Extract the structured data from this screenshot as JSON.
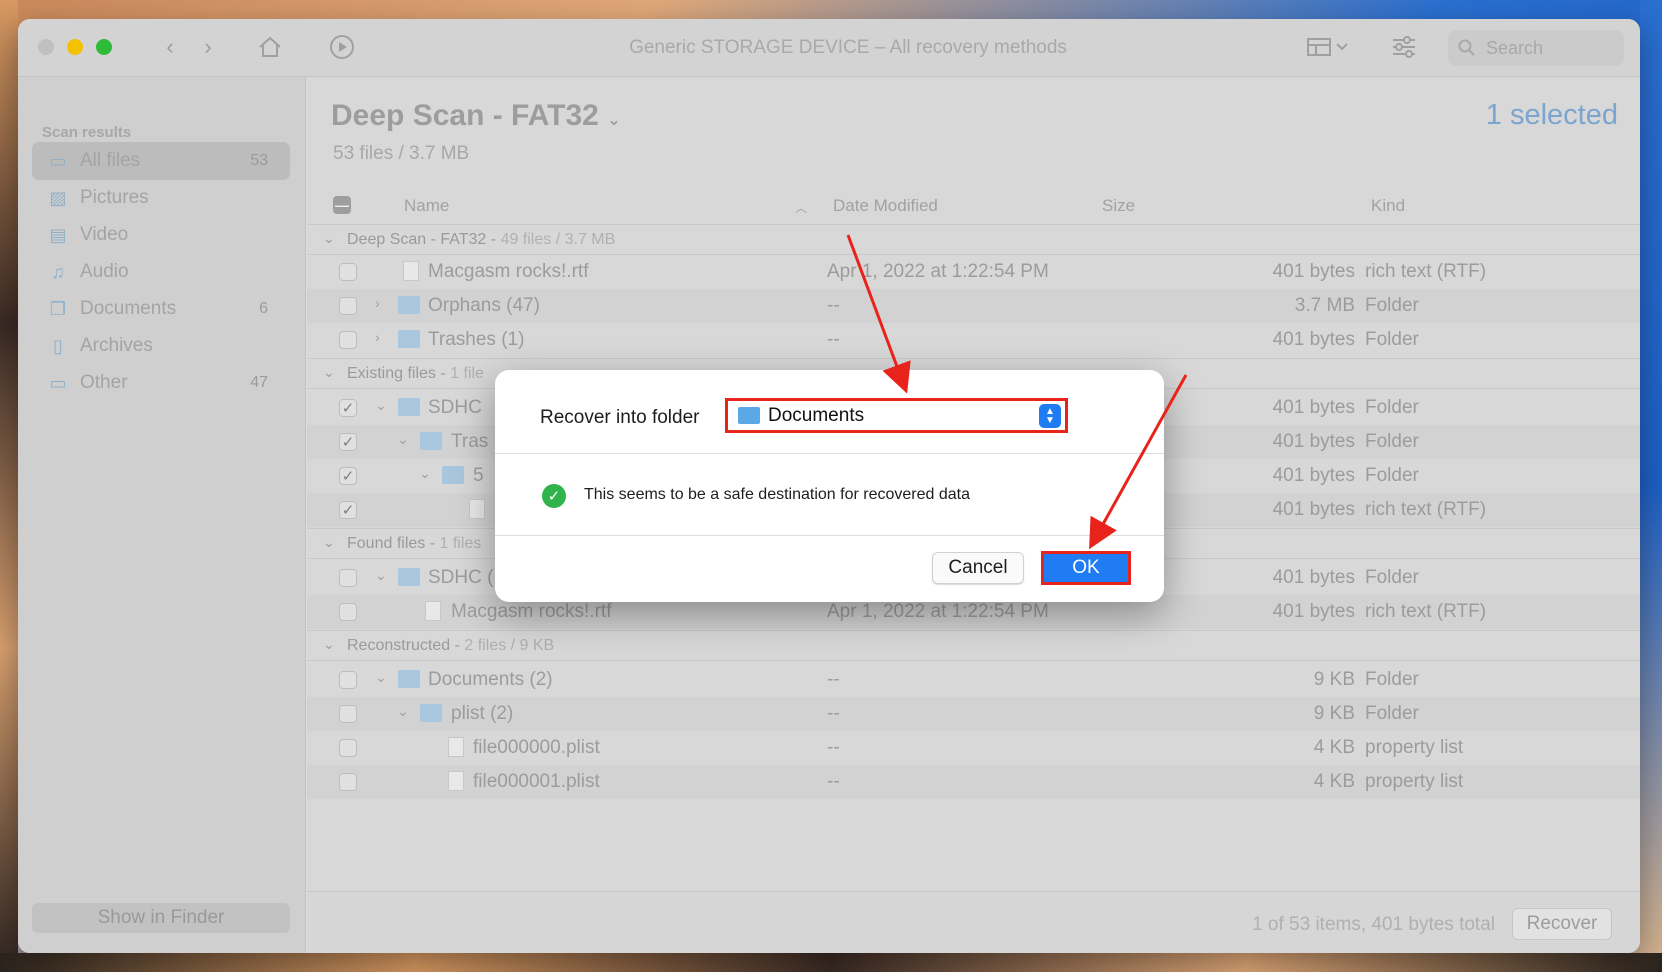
{
  "window": {
    "title": "Generic STORAGE DEVICE – All recovery methods",
    "search_placeholder": "Search"
  },
  "sidebar": {
    "header": "Scan results",
    "items": [
      {
        "label": "All files",
        "count": "53",
        "icon": "all-files-icon"
      },
      {
        "label": "Pictures",
        "count": "",
        "icon": "pictures-icon"
      },
      {
        "label": "Video",
        "count": "",
        "icon": "video-icon"
      },
      {
        "label": "Audio",
        "count": "",
        "icon": "audio-icon"
      },
      {
        "label": "Documents",
        "count": "6",
        "icon": "documents-icon"
      },
      {
        "label": "Archives",
        "count": "",
        "icon": "archives-icon"
      },
      {
        "label": "Other",
        "count": "47",
        "icon": "other-icon"
      }
    ],
    "show_in_finder": "Show in Finder"
  },
  "main": {
    "scan_title": "Deep Scan - FAT32",
    "scan_subtitle": "53 files / 3.7 MB",
    "selected": "1 selected",
    "columns": {
      "name": "Name",
      "date": "Date Modified",
      "size": "Size",
      "kind": "Kind"
    },
    "groups": {
      "deep": {
        "name": "Deep Scan - FAT32 -",
        "info": "49 files / 3.7 MB"
      },
      "existing": {
        "name": "Existing files -",
        "info": "1 file"
      },
      "found": {
        "name": "Found files -",
        "info": "1 files"
      },
      "reconstructed": {
        "name": "Reconstructed -",
        "info": "2 files / 9 KB"
      }
    },
    "rows": {
      "r1": {
        "name": "Macgasm rocks!.rtf",
        "date": "Apr 1, 2022 at 1:22:54 PM",
        "size": "401 bytes",
        "kind": "rich text (RTF)"
      },
      "r2": {
        "name": "Orphans (47)",
        "date": "--",
        "size": "3.7 MB",
        "kind": "Folder"
      },
      "r3": {
        "name": "Trashes (1)",
        "date": "--",
        "size": "401 bytes",
        "kind": "Folder"
      },
      "r4": {
        "name": "SDHC",
        "size": "401 bytes",
        "kind": "Folder"
      },
      "r5": {
        "name": "Tras",
        "size": "401 bytes",
        "kind": "Folder"
      },
      "r6": {
        "name": "5",
        "size": "401 bytes",
        "kind": "Folder"
      },
      "r7": {
        "size": "401 bytes",
        "kind": "rich text (RTF)"
      },
      "r8": {
        "name": "SDHC (1)",
        "date": "--",
        "size": "401 bytes",
        "kind": "Folder"
      },
      "r9": {
        "name": "Macgasm rocks!.rtf",
        "date": "Apr 1, 2022 at 1:22:54 PM",
        "size": "401 bytes",
        "kind": "rich text (RTF)"
      },
      "r10": {
        "name": "Documents (2)",
        "date": "--",
        "size": "9 KB",
        "kind": "Folder"
      },
      "r11": {
        "name": "plist (2)",
        "date": "--",
        "size": "9 KB",
        "kind": "Folder"
      },
      "r12": {
        "name": "file000000.plist",
        "date": "--",
        "size": "4 KB",
        "kind": "property list"
      },
      "r13": {
        "name": "file000001.plist",
        "date": "--",
        "size": "4 KB",
        "kind": "property list"
      }
    },
    "status": "1 of 53 items, 401 bytes total",
    "recover_button": "Recover"
  },
  "dialog": {
    "label": "Recover into folder",
    "selected_folder": "Documents",
    "message": "This seems to be a safe destination for recovered data",
    "cancel": "Cancel",
    "ok": "OK"
  },
  "colors": {
    "highlight": "#e8231b",
    "accent": "#1f7cf3",
    "success": "#2fb34a"
  }
}
